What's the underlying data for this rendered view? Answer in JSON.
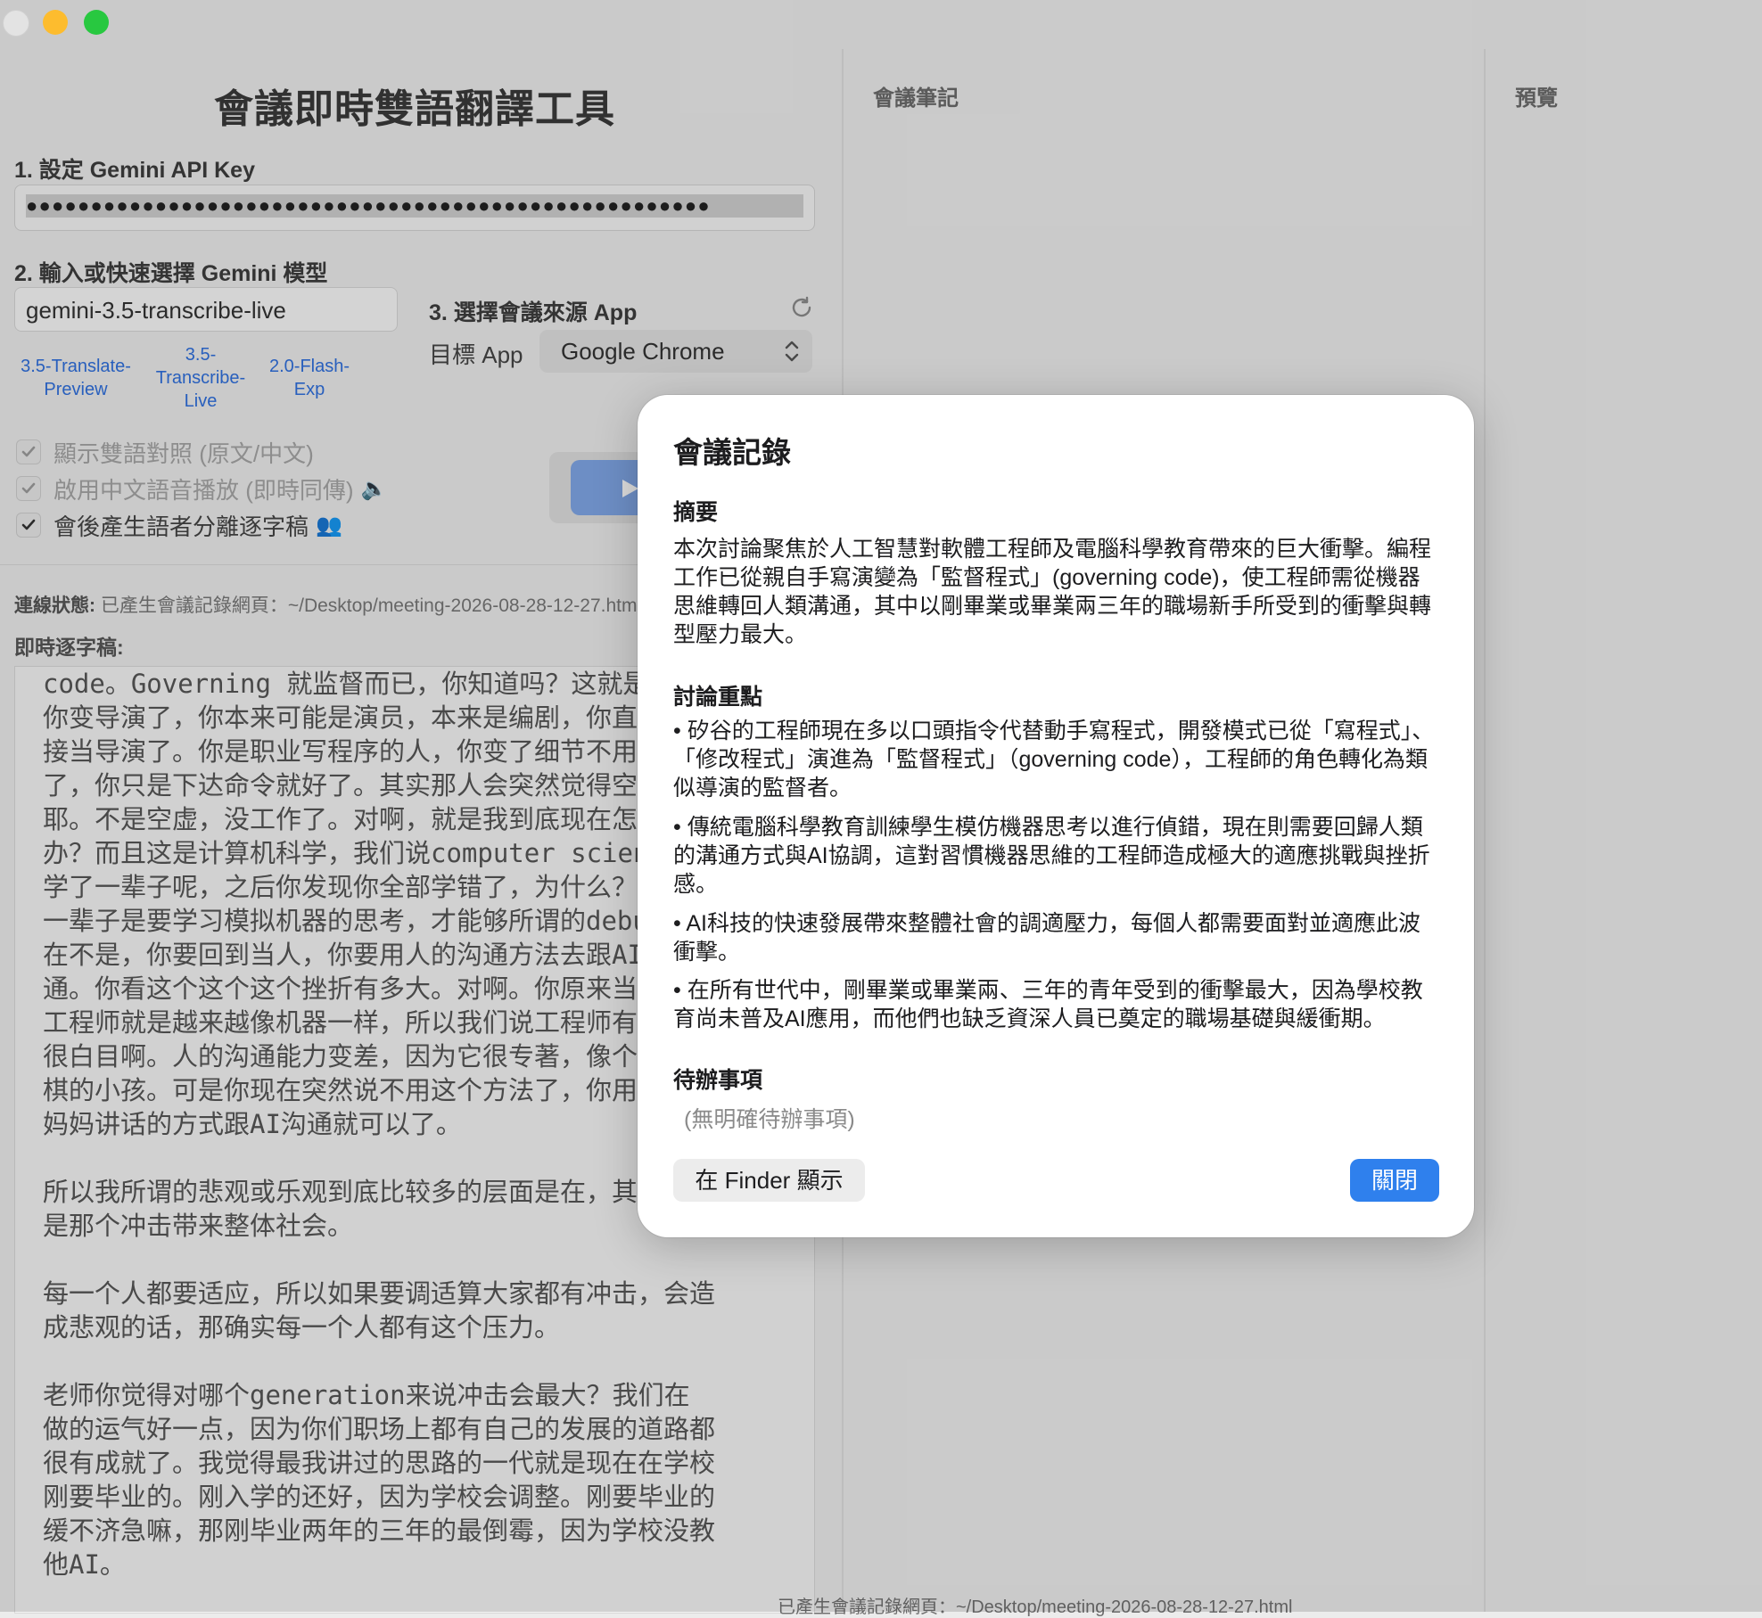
{
  "app": {
    "title": "會議即時雙語翻譯工具"
  },
  "api_key": {
    "label": "1. 設定 Gemini API Key",
    "masked_value": "●●●●●●●●●●●●●●●●●●●●●●●●●●●●●●●●●●●●●●●●●●●●●●●●●●●●●"
  },
  "model": {
    "label": "2. 輸入或快速選擇 Gemini 模型",
    "value": "gemini-3.5-transcribe-live",
    "quick_options": [
      "3.5-Translate-\nPreview",
      "3.5-\nTranscribe-\nLive",
      "2.0-Flash-\nExp"
    ]
  },
  "source_app": {
    "label": "3. 選擇會議來源 App",
    "target_label": "目標 App",
    "selected": "Google Chrome"
  },
  "options": [
    {
      "label": "顯示雙語對照 (原文/中文)",
      "checked": true,
      "enabled": false,
      "icon": ""
    },
    {
      "label": "啟用中文語音播放 (即時同傳)",
      "checked": true,
      "enabled": false,
      "icon": "🔈"
    },
    {
      "label": "會後產生語者分離逐字稿",
      "checked": true,
      "enabled": true,
      "icon": "👥"
    }
  ],
  "status": {
    "label": "連線狀態:",
    "value": "已產生會議記錄網頁：~/Desktop/meeting-2026-08-28-12-27.html"
  },
  "transcript": {
    "label": "即時逐字稿:",
    "text": "code。Governing 就监督而已，你知道吗？这就是\n你变导演了，你本来可能是演员，本来是编剧，你直\n接当导演了。你是职业写程序的人，你变了细节不用管\n了，你只是下达命令就好了。其实那人会突然觉得空虚\n耶。不是空虚，没工作了。对啊，就是我到底现在怎么\n办？而且这是计算机科学，我们说computer science，\n学了一辈子呢，之后你发现你全部学错了，为什么？你\n一辈子是要学习模拟机器的思考，才能够所谓的debug。现\n在不是，你要回到当人，你要用人的沟通方法去跟AI沟\n通。你看这个这个这个挫折有多大。对啊。你原来当个\n工程师就是越来越像机器一样，所以我们说工程师有时候\n很白目啊。人的沟通能力变差，因为它很专著，像个下\n棋的小孩。可是你现在突然说不用这个方法了，你用跟\n妈妈讲话的方式跟AI沟通就可以了。\n\n所以我所谓的悲观或乐观到底比较多的层面是在，其实\n是那个冲击带来整体社会。\n\n每一个人都要适应，所以如果要调适算大家都有冲击，会造\n成悲观的话，那确实每一个人都有这个压力。\n\n老师你觉得对哪个generation来说冲击会最大？我们在\n做的运气好一点，因为你们职场上都有自己的发展的道路都\n很有成就了。我觉得最我讲过的思路的一代就是现在在学校\n刚要毕业的。刚入学的还好，因为学校会调整。刚要毕业的\n缓不济急嘛，那刚毕业两年的三年的最倒霉，因为学校没教\n他AI。"
  },
  "columns": {
    "notes_heading": "會議筆記",
    "preview_heading": "預覽"
  },
  "bottom_status": "已產生會議記錄網頁：~/Desktop/meeting-2026-08-28-12-27.html",
  "modal": {
    "title": "會議記錄",
    "summary_heading": "摘要",
    "summary": "本次討論聚焦於人工智慧對軟體工程師及電腦科學教育帶來的巨大衝擊。編程工作已從親自手寫演變為「監督程式」(governing code)，使工程師需從機器思維轉回人類溝通，其中以剛畢業或畢業兩三年的職場新手所受到的衝擊與轉型壓力最大。",
    "points_heading": "討論重點",
    "points": [
      "• 矽谷的工程師現在多以口頭指令代替動手寫程式，開發模式已從「寫程式」、「修改程式」演進為「監督程式」（governing code），工程師的角色轉化為類似導演的監督者。",
      "• 傳統電腦科學教育訓練學生模仿機器思考以進行偵錯，現在則需要回歸人類的溝通方式與AI協調，這對習慣機器思維的工程師造成極大的適應挑戰與挫折感。",
      "• AI科技的快速發展帶來整體社會的調適壓力，每個人都需要面對並適應此波衝擊。",
      "• 在所有世代中，剛畢業或畢業兩、三年的青年受到的衝擊最大，因為學校教育尚未普及AI應用，而他們也缺乏資深人員已奠定的職場基礎與緩衝期。"
    ],
    "todo_heading": "待辦事項",
    "todo_empty": "(無明確待辦事項)",
    "finder_button": "在 Finder 顯示",
    "close_button": "關閉"
  },
  "colors": {
    "accent": "#2f80ed",
    "link": "#2f6fdc",
    "play_button": "#7fa6e6"
  }
}
